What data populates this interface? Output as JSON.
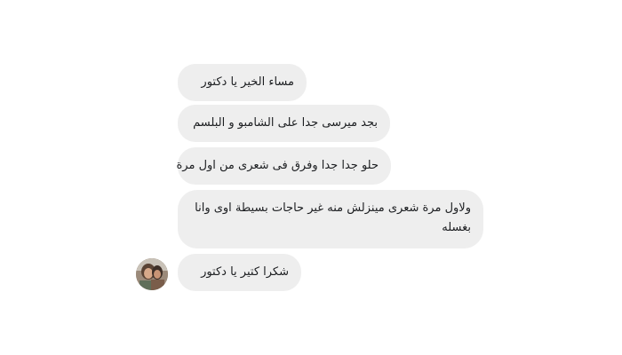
{
  "messages": [
    {
      "text": "مساء الخير يا دكتور"
    },
    {
      "text": "بجد ميرسى جدا على الشامبو و البلسم"
    },
    {
      "text": "حلو جدا جدا وفرق فى شعرى من اول مرة"
    },
    {
      "text": "ولاول مرة شعرى مينزلش منه غير حاجات بسيطة اوى وانا بغسله"
    },
    {
      "text": "شكرا كتير يا دكتور"
    }
  ],
  "colors": {
    "bubble_background": "#eeeeee",
    "text": "#1c1e21",
    "page_background": "#ffffff"
  },
  "icons": {
    "avatar": "contact-profile-photo"
  }
}
